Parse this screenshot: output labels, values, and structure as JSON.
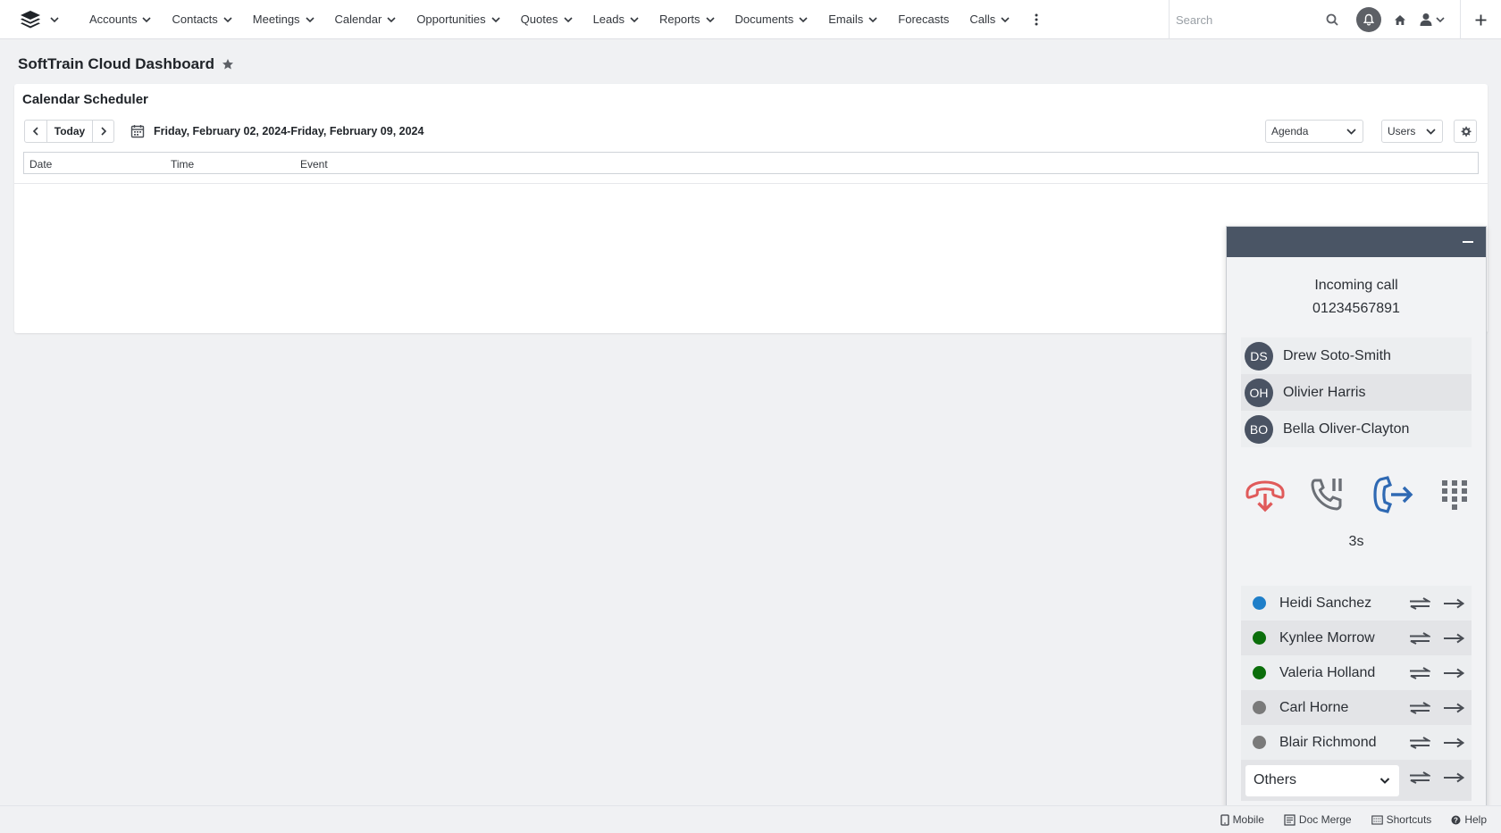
{
  "nav": {
    "items": [
      {
        "label": "Accounts",
        "has_menu": true
      },
      {
        "label": "Contacts",
        "has_menu": true
      },
      {
        "label": "Meetings",
        "has_menu": true
      },
      {
        "label": "Calendar",
        "has_menu": true
      },
      {
        "label": "Opportunities",
        "has_menu": true
      },
      {
        "label": "Quotes",
        "has_menu": true
      },
      {
        "label": "Leads",
        "has_menu": true
      },
      {
        "label": "Reports",
        "has_menu": true
      },
      {
        "label": "Documents",
        "has_menu": true
      },
      {
        "label": "Emails",
        "has_menu": true
      },
      {
        "label": "Forecasts",
        "has_menu": false
      },
      {
        "label": "Calls",
        "has_menu": true
      }
    ],
    "search_placeholder": "Search"
  },
  "page": {
    "title": "SoftTrain Cloud Dashboard"
  },
  "dashlet": {
    "title": "Calendar Scheduler",
    "today_label": "Today",
    "date_range": "Friday, February 02, 2024-Friday, February 09, 2024",
    "view_select": "Agenda",
    "users_select": "Users",
    "columns": [
      "Date",
      "Time",
      "Event"
    ]
  },
  "call_widget": {
    "status": "Incoming call",
    "number": "01234567891",
    "contacts": [
      {
        "initials": "DS",
        "name": "Drew Soto-Smith"
      },
      {
        "initials": "OH",
        "name": "Olivier Harris"
      },
      {
        "initials": "BO",
        "name": "Bella Oliver-Clayton"
      }
    ],
    "timer": "3s",
    "transfer_users": [
      {
        "name": "Heidi Sanchez",
        "status_color": "#1f7fc9"
      },
      {
        "name": "Kynlee Morrow",
        "status_color": "#0b6e0b"
      },
      {
        "name": "Valeria Holland",
        "status_color": "#0b6e0b"
      },
      {
        "name": "Carl Horne",
        "status_color": "#7a7a7a"
      },
      {
        "name": "Blair Richmond",
        "status_color": "#7a7a7a"
      }
    ],
    "others_label": "Others",
    "colors": {
      "header": "#4a5565",
      "hangup": "#e05a5a",
      "hold": "#6b6f76",
      "transfer": "#2f69b3"
    }
  },
  "footer": {
    "links": [
      "Mobile",
      "Doc Merge",
      "Shortcuts",
      "Help"
    ]
  }
}
